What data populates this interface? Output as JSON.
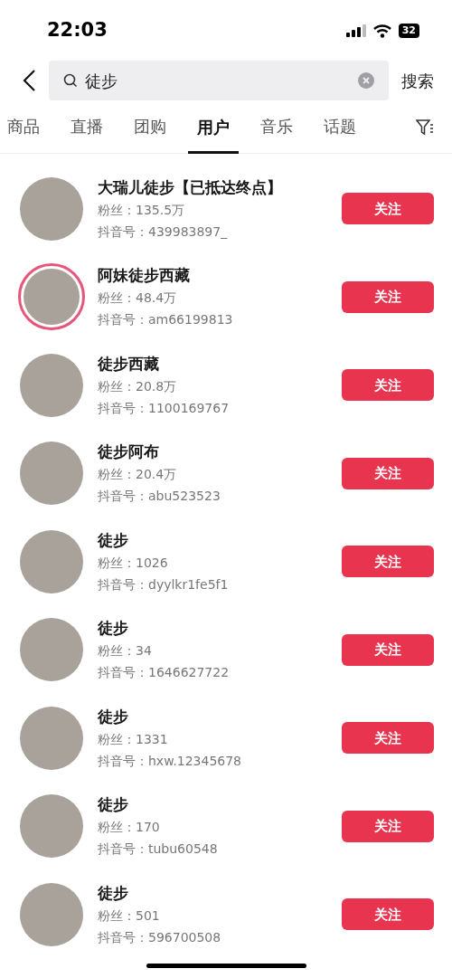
{
  "status_bar": {
    "time": "22:03",
    "battery": "32"
  },
  "search": {
    "value": "徒步",
    "action": "搜索"
  },
  "tabs": [
    {
      "label": "商品",
      "selected": false
    },
    {
      "label": "直播",
      "selected": false
    },
    {
      "label": "团购",
      "selected": false
    },
    {
      "label": "用户",
      "selected": true
    },
    {
      "label": "音乐",
      "selected": false
    },
    {
      "label": "话题",
      "selected": false
    }
  ],
  "users": [
    {
      "name": "大瑞儿徒步【已抵达终点】",
      "fans": "粉丝：135.5万",
      "id": "抖音号：439983897_",
      "live": false,
      "button": "关注"
    },
    {
      "name": "阿妹徒步西藏",
      "fans": "粉丝：48.4万",
      "id": "抖音号：am66199813",
      "live": true,
      "button": "关注"
    },
    {
      "name": "徒步西藏",
      "fans": "粉丝：20.8万",
      "id": "抖音号：1100169767",
      "live": false,
      "button": "关注"
    },
    {
      "name": "徒步阿布",
      "fans": "粉丝：20.4万",
      "id": "抖音号：abu523523",
      "live": false,
      "button": "关注"
    },
    {
      "name": "徒步",
      "fans": "粉丝：1026",
      "id": "抖音号：dyylkr1fe5f1",
      "live": false,
      "button": "关注"
    },
    {
      "name": "徒步",
      "fans": "粉丝：34",
      "id": "抖音号：1646627722",
      "live": false,
      "button": "关注"
    },
    {
      "name": "徒步",
      "fans": "粉丝：1331",
      "id": "抖音号：hxw.12345678",
      "live": false,
      "button": "关注"
    },
    {
      "name": "徒步",
      "fans": "粉丝：170",
      "id": "抖音号：tubu60548",
      "live": false,
      "button": "关注"
    },
    {
      "name": "徒步",
      "fans": "粉丝：501",
      "id": "抖音号：596700508",
      "live": false,
      "button": "关注"
    }
  ]
}
